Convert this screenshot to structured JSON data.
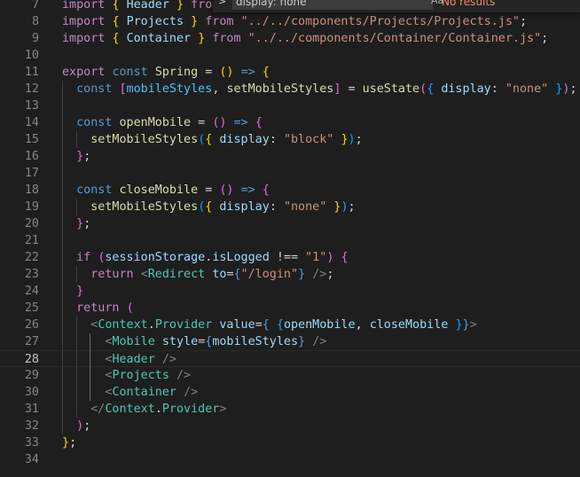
{
  "find_widget": {
    "toggle_icon": "chevron-right-icon",
    "query": "display: none",
    "match_case_icon": "Aa",
    "whole_word_icon": "ab",
    "result_text": "No results"
  },
  "colors": {
    "background": "#1e1e1e",
    "keyword": "#c586c0",
    "storage": "#569cd6",
    "variable": "#9cdcfe",
    "function": "#dcdcaa",
    "string": "#ce9178",
    "jsx_tag": "#4ec9b0"
  },
  "editor": {
    "current_line": 28,
    "lines": [
      {
        "num": 7,
        "tokens": [
          [
            "keyword",
            "import"
          ],
          [
            "punct",
            " "
          ],
          [
            "b1",
            "{"
          ],
          [
            "punct",
            " "
          ],
          [
            "var",
            "Header"
          ],
          [
            "punct",
            " "
          ],
          [
            "b1",
            "}"
          ],
          [
            "punct",
            " "
          ],
          [
            "keyword",
            "from"
          ]
        ]
      },
      {
        "num": 8,
        "tokens": [
          [
            "keyword",
            "import"
          ],
          [
            "punct",
            " "
          ],
          [
            "b1",
            "{"
          ],
          [
            "punct",
            " "
          ],
          [
            "var",
            "Projects"
          ],
          [
            "punct",
            " "
          ],
          [
            "b1",
            "}"
          ],
          [
            "punct",
            " "
          ],
          [
            "keyword",
            "from"
          ],
          [
            "punct",
            " "
          ],
          [
            "string",
            "\"../../components/Projects/Projects.js\""
          ],
          [
            "punct",
            ";"
          ]
        ]
      },
      {
        "num": 9,
        "tokens": [
          [
            "keyword",
            "import"
          ],
          [
            "punct",
            " "
          ],
          [
            "b1",
            "{"
          ],
          [
            "punct",
            " "
          ],
          [
            "var",
            "Container"
          ],
          [
            "punct",
            " "
          ],
          [
            "b1",
            "}"
          ],
          [
            "punct",
            " "
          ],
          [
            "keyword",
            "from"
          ],
          [
            "punct",
            " "
          ],
          [
            "string",
            "\"../../components/Container/Container.js\""
          ],
          [
            "punct",
            ";"
          ]
        ]
      },
      {
        "num": 10,
        "tokens": []
      },
      {
        "num": 11,
        "tokens": [
          [
            "keyword",
            "export"
          ],
          [
            "punct",
            " "
          ],
          [
            "storage",
            "const"
          ],
          [
            "punct",
            " "
          ],
          [
            "func",
            "Spring"
          ],
          [
            "punct",
            " = "
          ],
          [
            "b1",
            "()"
          ],
          [
            "punct",
            " "
          ],
          [
            "storage",
            "=>"
          ],
          [
            "punct",
            " "
          ],
          [
            "b1",
            "{"
          ]
        ]
      },
      {
        "num": 12,
        "tokens": [
          [
            "punct",
            "  "
          ],
          [
            "storage",
            "const"
          ],
          [
            "punct",
            " "
          ],
          [
            "b2",
            "["
          ],
          [
            "const",
            "mobileStyles"
          ],
          [
            "punct",
            ", "
          ],
          [
            "func",
            "setMobileStyles"
          ],
          [
            "b2",
            "]"
          ],
          [
            "punct",
            " = "
          ],
          [
            "func",
            "useState"
          ],
          [
            "b2",
            "("
          ],
          [
            "b3",
            "{"
          ],
          [
            "punct",
            " "
          ],
          [
            "var",
            "display"
          ],
          [
            "punct",
            ": "
          ],
          [
            "string",
            "\"none\""
          ],
          [
            "punct",
            " "
          ],
          [
            "b3",
            "}"
          ],
          [
            "b2",
            ")"
          ],
          [
            "punct",
            ";"
          ]
        ]
      },
      {
        "num": 13,
        "tokens": []
      },
      {
        "num": 14,
        "tokens": [
          [
            "punct",
            "  "
          ],
          [
            "storage",
            "const"
          ],
          [
            "punct",
            " "
          ],
          [
            "func",
            "openMobile"
          ],
          [
            "punct",
            " = "
          ],
          [
            "b2",
            "()"
          ],
          [
            "punct",
            " "
          ],
          [
            "storage",
            "=>"
          ],
          [
            "punct",
            " "
          ],
          [
            "b2",
            "{"
          ]
        ]
      },
      {
        "num": 15,
        "tokens": [
          [
            "punct",
            "    "
          ],
          [
            "func",
            "setMobileStyles"
          ],
          [
            "b3",
            "("
          ],
          [
            "b1",
            "{"
          ],
          [
            "punct",
            " "
          ],
          [
            "var",
            "display"
          ],
          [
            "punct",
            ": "
          ],
          [
            "string",
            "\"block\""
          ],
          [
            "punct",
            " "
          ],
          [
            "b1",
            "}"
          ],
          [
            "b3",
            ")"
          ],
          [
            "punct",
            ";"
          ]
        ]
      },
      {
        "num": 16,
        "tokens": [
          [
            "punct",
            "  "
          ],
          [
            "b2",
            "}"
          ],
          [
            "punct",
            ";"
          ]
        ]
      },
      {
        "num": 17,
        "tokens": []
      },
      {
        "num": 18,
        "tokens": [
          [
            "punct",
            "  "
          ],
          [
            "storage",
            "const"
          ],
          [
            "punct",
            " "
          ],
          [
            "func",
            "closeMobile"
          ],
          [
            "punct",
            " = "
          ],
          [
            "b2",
            "()"
          ],
          [
            "punct",
            " "
          ],
          [
            "storage",
            "=>"
          ],
          [
            "punct",
            " "
          ],
          [
            "b2",
            "{"
          ]
        ]
      },
      {
        "num": 19,
        "tokens": [
          [
            "punct",
            "    "
          ],
          [
            "func",
            "setMobileStyles"
          ],
          [
            "b3",
            "("
          ],
          [
            "b1",
            "{"
          ],
          [
            "punct",
            " "
          ],
          [
            "var",
            "display"
          ],
          [
            "punct",
            ": "
          ],
          [
            "string",
            "\"none\""
          ],
          [
            "punct",
            " "
          ],
          [
            "b1",
            "}"
          ],
          [
            "b3",
            ")"
          ],
          [
            "punct",
            ";"
          ]
        ]
      },
      {
        "num": 20,
        "tokens": [
          [
            "punct",
            "  "
          ],
          [
            "b2",
            "}"
          ],
          [
            "punct",
            ";"
          ]
        ]
      },
      {
        "num": 21,
        "tokens": []
      },
      {
        "num": 22,
        "tokens": [
          [
            "punct",
            "  "
          ],
          [
            "keyword",
            "if"
          ],
          [
            "punct",
            " "
          ],
          [
            "b2",
            "("
          ],
          [
            "var",
            "sessionStorage"
          ],
          [
            "punct",
            "."
          ],
          [
            "var",
            "isLogged"
          ],
          [
            "punct",
            " !== "
          ],
          [
            "string",
            "\"1\""
          ],
          [
            "b2",
            ")"
          ],
          [
            "punct",
            " "
          ],
          [
            "b2",
            "{"
          ]
        ]
      },
      {
        "num": 23,
        "tokens": [
          [
            "punct",
            "    "
          ],
          [
            "keyword",
            "return"
          ],
          [
            "punct",
            " "
          ],
          [
            "tagpunct",
            "<"
          ],
          [
            "tag",
            "Redirect"
          ],
          [
            "punct",
            " "
          ],
          [
            "var",
            "to"
          ],
          [
            "punct",
            "="
          ],
          [
            "storage",
            "{"
          ],
          [
            "string",
            "\"/login\""
          ],
          [
            "storage",
            "}"
          ],
          [
            "punct",
            " "
          ],
          [
            "tagpunct",
            "/>"
          ],
          [
            "punct",
            ";"
          ]
        ]
      },
      {
        "num": 24,
        "tokens": [
          [
            "punct",
            "  "
          ],
          [
            "b2",
            "}"
          ]
        ]
      },
      {
        "num": 25,
        "tokens": [
          [
            "punct",
            "  "
          ],
          [
            "keyword",
            "return"
          ],
          [
            "punct",
            " "
          ],
          [
            "b2",
            "("
          ]
        ]
      },
      {
        "num": 26,
        "tokens": [
          [
            "punct",
            "    "
          ],
          [
            "tagpunct",
            "<"
          ],
          [
            "tag",
            "Context"
          ],
          [
            "punct",
            "."
          ],
          [
            "tag",
            "Provider"
          ],
          [
            "punct",
            " "
          ],
          [
            "var",
            "value"
          ],
          [
            "punct",
            "="
          ],
          [
            "storage",
            "{"
          ],
          [
            "punct",
            " "
          ],
          [
            "b3",
            "{"
          ],
          [
            "var",
            "openMobile"
          ],
          [
            "punct",
            ", "
          ],
          [
            "var",
            "closeMobile"
          ],
          [
            "punct",
            " "
          ],
          [
            "b3",
            "}"
          ],
          [
            "storage",
            "}"
          ],
          [
            "tagpunct",
            ">"
          ]
        ]
      },
      {
        "num": 27,
        "tokens": [
          [
            "punct",
            "      "
          ],
          [
            "tagpunct",
            "<"
          ],
          [
            "tag",
            "Mobile"
          ],
          [
            "punct",
            " "
          ],
          [
            "var",
            "style"
          ],
          [
            "punct",
            "="
          ],
          [
            "storage",
            "{"
          ],
          [
            "var",
            "mobileStyles"
          ],
          [
            "storage",
            "}"
          ],
          [
            "punct",
            " "
          ],
          [
            "tagpunct",
            "/>"
          ]
        ]
      },
      {
        "num": 28,
        "tokens": [
          [
            "punct",
            "      "
          ],
          [
            "tagpunct",
            "<"
          ],
          [
            "tag",
            "Header"
          ],
          [
            "punct",
            " "
          ],
          [
            "tagpunct",
            "/>"
          ]
        ]
      },
      {
        "num": 29,
        "tokens": [
          [
            "punct",
            "      "
          ],
          [
            "tagpunct",
            "<"
          ],
          [
            "tag",
            "Projects"
          ],
          [
            "punct",
            " "
          ],
          [
            "tagpunct",
            "/>"
          ]
        ]
      },
      {
        "num": 30,
        "tokens": [
          [
            "punct",
            "      "
          ],
          [
            "tagpunct",
            "<"
          ],
          [
            "tag",
            "Container"
          ],
          [
            "punct",
            " "
          ],
          [
            "tagpunct",
            "/>"
          ]
        ]
      },
      {
        "num": 31,
        "tokens": [
          [
            "punct",
            "    "
          ],
          [
            "tagpunct",
            "</"
          ],
          [
            "tag",
            "Context"
          ],
          [
            "punct",
            "."
          ],
          [
            "tag",
            "Provider"
          ],
          [
            "tagpunct",
            ">"
          ]
        ]
      },
      {
        "num": 32,
        "tokens": [
          [
            "punct",
            "  "
          ],
          [
            "b2",
            ")"
          ],
          [
            "punct",
            ";"
          ]
        ]
      },
      {
        "num": 33,
        "tokens": [
          [
            "b1",
            "}"
          ],
          [
            "punct",
            ";"
          ]
        ]
      },
      {
        "num": 34,
        "tokens": []
      }
    ]
  }
}
